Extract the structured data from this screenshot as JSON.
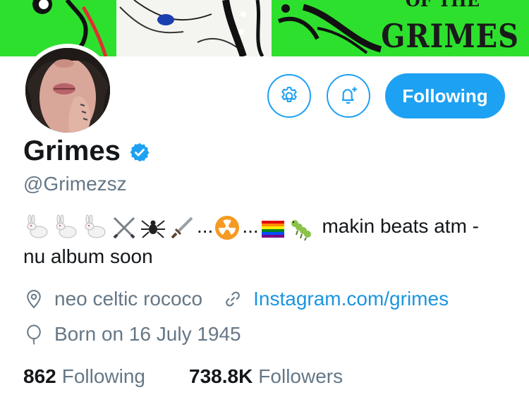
{
  "banner": {
    "text": "GRIMES",
    "text_top": "OF THE"
  },
  "profile": {
    "name": "Grimes",
    "handle": "@Grimezsz",
    "verified": true,
    "bio_text_1": "makin beats atm -",
    "bio_text_2": "nu album soon",
    "bio_emojis": [
      "rabbit",
      "rabbit",
      "rabbit",
      "crossed-swords",
      "spider",
      "dagger",
      "radioactive",
      "rainbow-flag",
      "bug"
    ],
    "bio_ellipsis": "...",
    "location": "neo celtic rococo",
    "website": "Instagram.com/grimes",
    "birthday": "Born on 16 July 1945"
  },
  "actions": {
    "follow_label": "Following"
  },
  "stats": {
    "following_count": "862",
    "following_label": "Following",
    "followers_count": "738.8K",
    "followers_label": "Followers"
  },
  "colors": {
    "accent": "#1da1f2",
    "link": "#1b95e0",
    "banner_green": "#2ee02e",
    "secondary_text": "#657786"
  }
}
